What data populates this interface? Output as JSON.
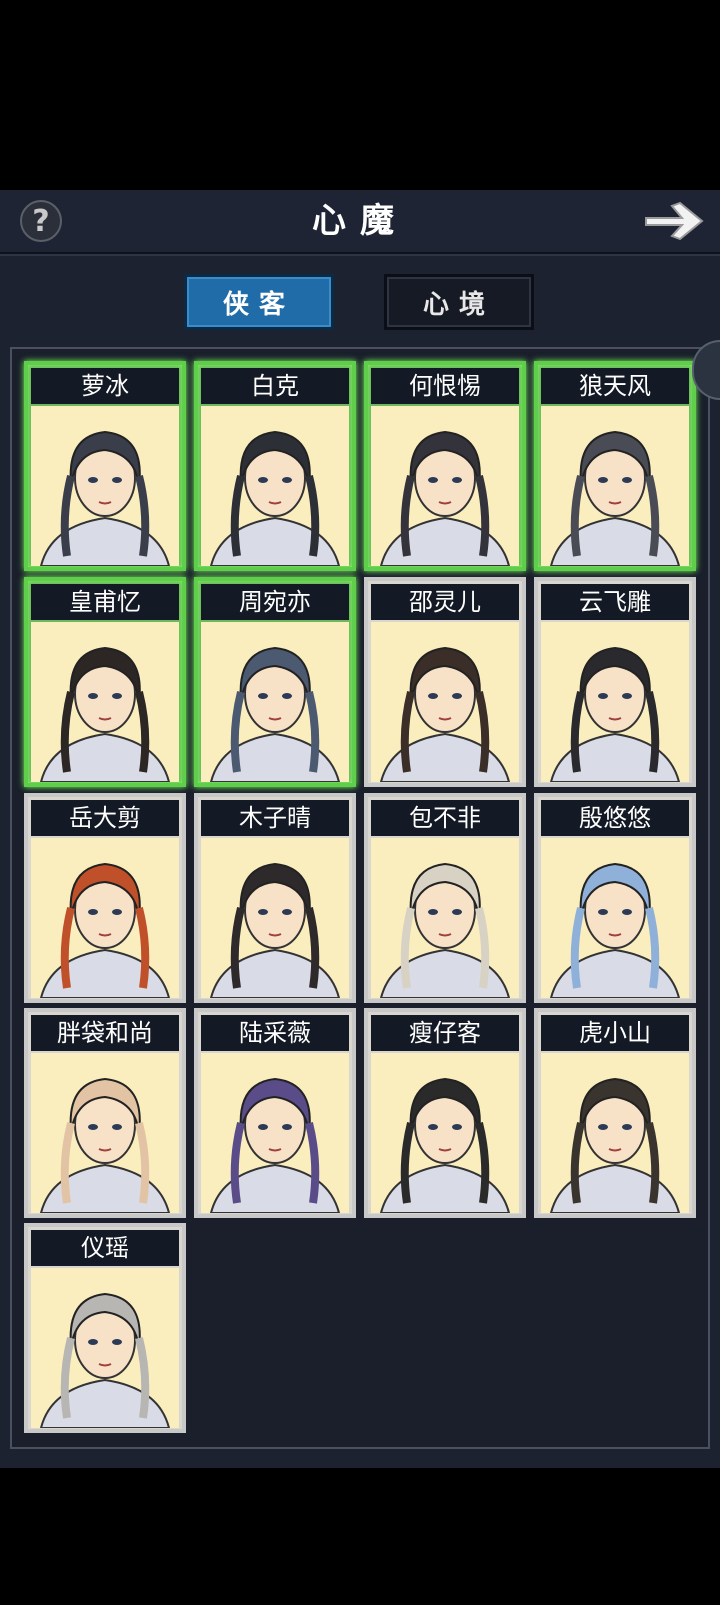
{
  "header": {
    "title": "心魔",
    "help_icon": "question-mark-icon",
    "next_icon": "arrow-right-icon"
  },
  "tabs": [
    {
      "label": "侠客",
      "active": true
    },
    {
      "label": "心境",
      "active": false
    }
  ],
  "colors": {
    "panel_bg": "#1c2230",
    "tab_active": "#1f6ca8",
    "unlocked_border": "#5fce4a",
    "portrait_bg": "#fbeebe"
  },
  "characters": [
    {
      "name": "萝冰",
      "unlocked": true
    },
    {
      "name": "白克",
      "unlocked": true
    },
    {
      "name": "何恨惕",
      "unlocked": true
    },
    {
      "name": "狼天风",
      "unlocked": true
    },
    {
      "name": "皇甫忆",
      "unlocked": true
    },
    {
      "name": "周宛亦",
      "unlocked": true
    },
    {
      "name": "邵灵儿",
      "unlocked": false
    },
    {
      "name": "云飞雕",
      "unlocked": false
    },
    {
      "name": "岳大剪",
      "unlocked": false
    },
    {
      "name": "木子晴",
      "unlocked": false
    },
    {
      "name": "包不非",
      "unlocked": false
    },
    {
      "name": "殷悠悠",
      "unlocked": false
    },
    {
      "name": "胖袋和尚",
      "unlocked": false
    },
    {
      "name": "陆采薇",
      "unlocked": false
    },
    {
      "name": "瘦仔客",
      "unlocked": false
    },
    {
      "name": "虎小山",
      "unlocked": false
    },
    {
      "name": "仪瑶",
      "unlocked": false
    }
  ]
}
